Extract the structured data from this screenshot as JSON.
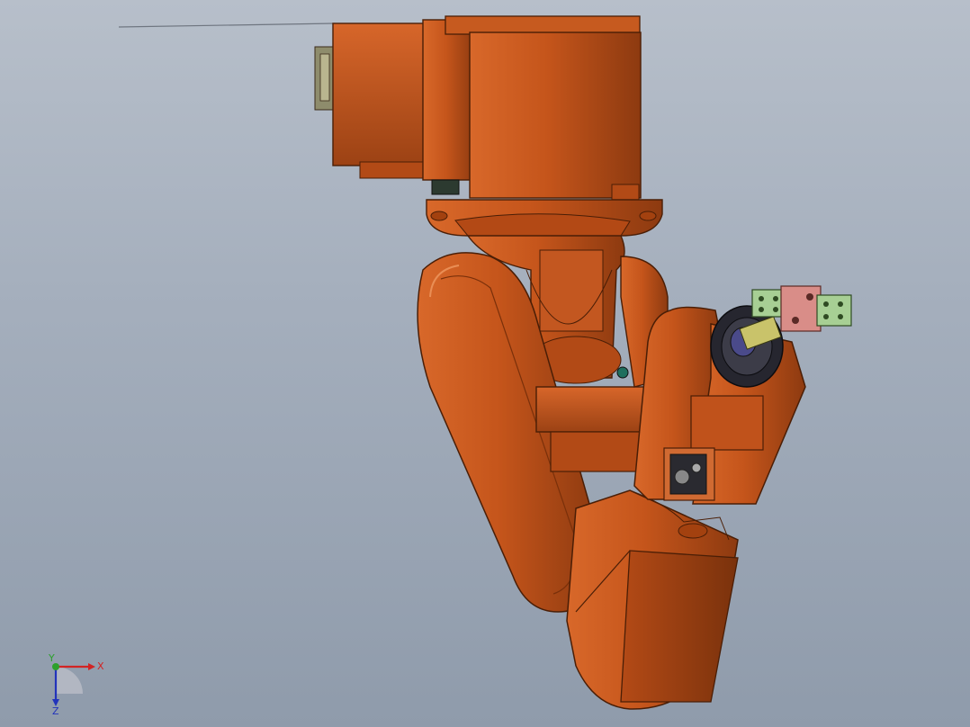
{
  "viewport": {
    "background_top": "#b7bfca",
    "background_bottom": "#8f9bab"
  },
  "model": {
    "type": "industrial-robot-arm",
    "body_color": "#c8561a",
    "body_shadow": "#8a3a0f",
    "body_highlight": "#e07a3c",
    "gripper_finger_color": "#9ec48e",
    "gripper_block_color": "#d98b85",
    "flange_color": "#2a2a35"
  },
  "triad": {
    "x_label": "X",
    "y_label": "Y",
    "z_label": "Z",
    "x_color": "#d22424",
    "y_color": "#2ca02c",
    "z_color": "#2233bb"
  }
}
